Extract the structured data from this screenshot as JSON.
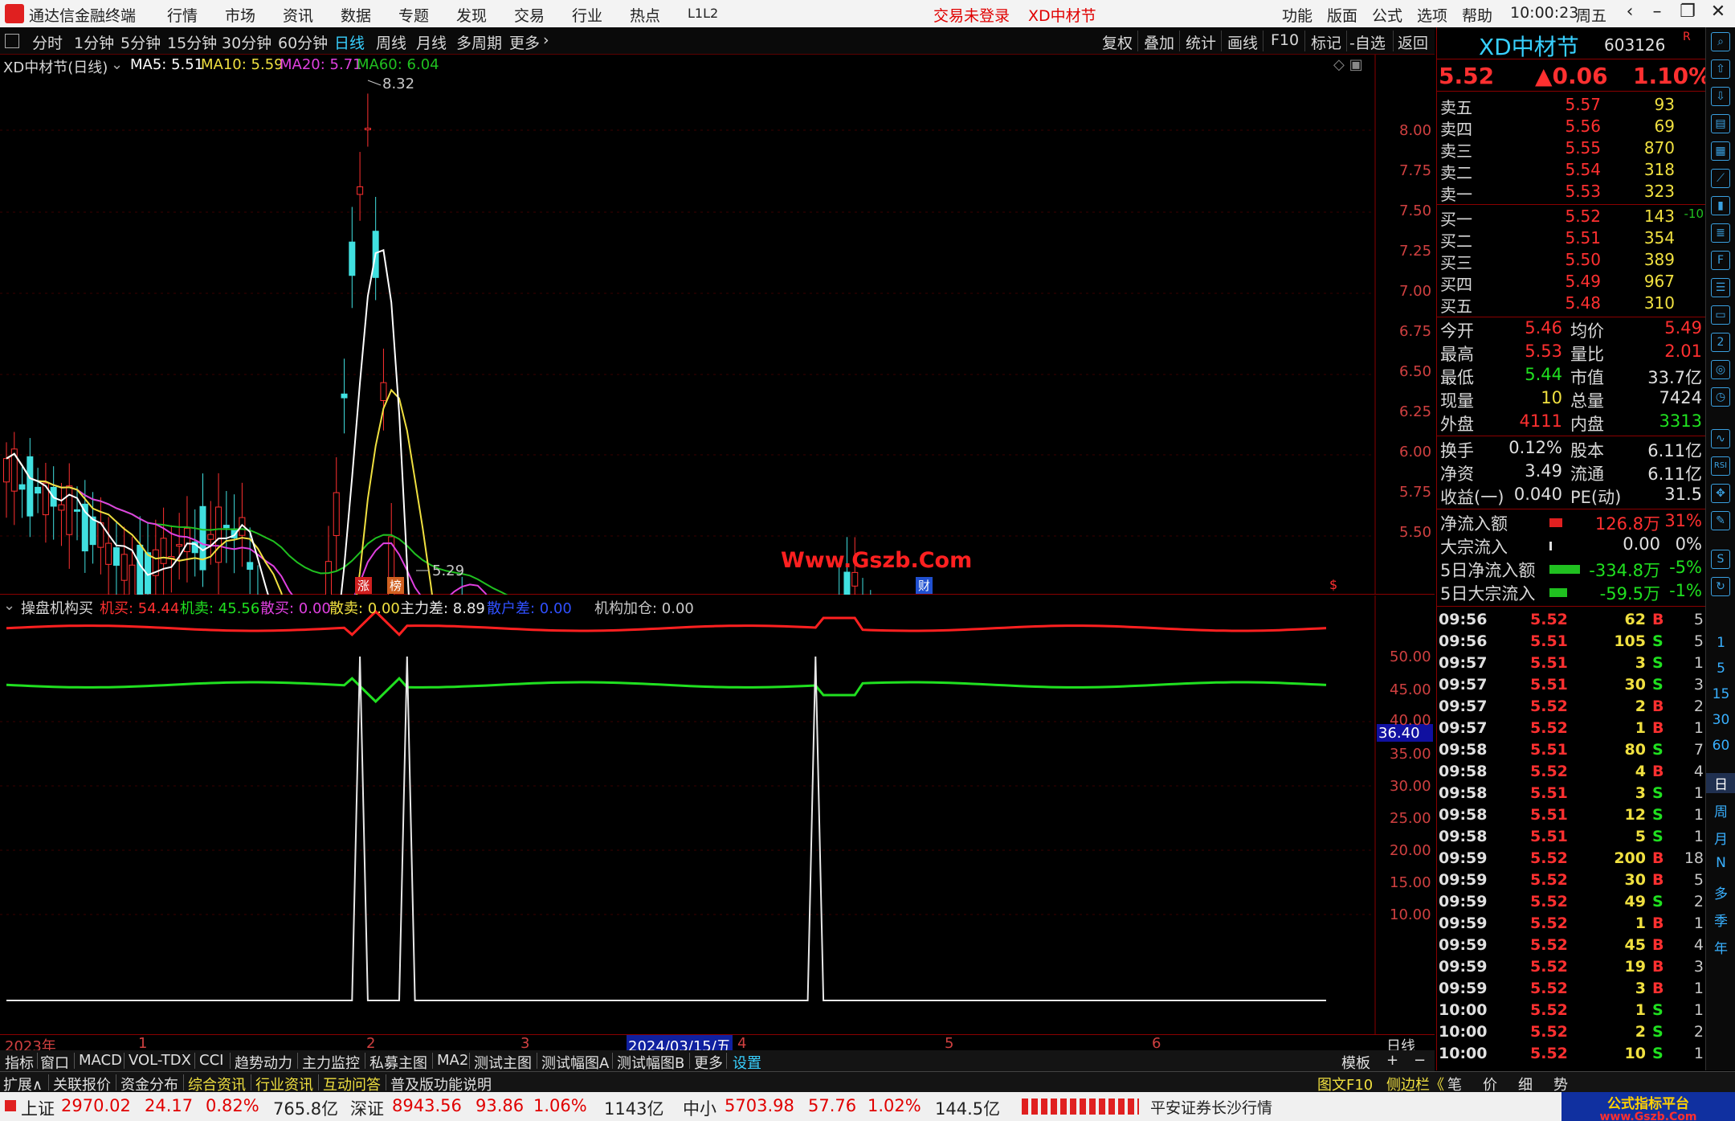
{
  "titlebar": {
    "brand": "通达信金融终端",
    "menu": [
      "行情",
      "市场",
      "资讯",
      "数据",
      "专题",
      "发现",
      "交易",
      "行业",
      "热点",
      "L1L2"
    ],
    "login": "交易未登录",
    "stock": "XD中材节",
    "right_menu": [
      "功能",
      "版面",
      "公式",
      "选项",
      "帮助"
    ],
    "time": "10:00:23",
    "weekday": "周五"
  },
  "periods": [
    "分时",
    "1分钟",
    "5分钟",
    "15分钟",
    "30分钟",
    "60分钟",
    "日线",
    "周线",
    "月线",
    "多周期",
    "更多"
  ],
  "active_period": "日线",
  "toolbar_right": [
    "复权",
    "叠加",
    "统计",
    "画线",
    "F10",
    "标记",
    "-自选",
    "返回"
  ],
  "main_header": {
    "title": "XD中材节(日线)",
    "ma5": "MA5: 5.51",
    "ma10": "MA10: 5.59",
    "ma20": "MA20: 5.71",
    "ma60": "MA60: 6.04"
  },
  "price_axis": [
    "8.00",
    "7.75",
    "7.50",
    "7.25",
    "7.00",
    "6.75",
    "6.50",
    "6.25",
    "6.00",
    "5.75",
    "5.50"
  ],
  "high_label": "8.32",
  "low_label": "5.29",
  "watermark": "Www.Gszb.Com",
  "markers": {
    "zhang": "涨",
    "bang": "榜",
    "cai": "财",
    "s": "$"
  },
  "ind_header": {
    "name": "操盘机构买",
    "jm": "机买: 54.44",
    "jmc": "机卖: 45.56",
    "sm": "散买: 0.00",
    "smc": "散卖: 0.00",
    "zlc": "主力差: 8.89",
    "shc": "散户差: 0.00",
    "jgjc": "机构加仓: 0.00"
  },
  "ind_axis": [
    "50.00",
    "45.00",
    "40.00",
    "35.00",
    "30.00",
    "25.00",
    "20.00",
    "15.00",
    "10.00"
  ],
  "ind_tag": "36.40",
  "datebar": {
    "year": "2023年",
    "m1": "1",
    "m2": "2",
    "m3": "3",
    "date": "2024/03/15/五",
    "m4": "4",
    "m5": "5",
    "m6": "6",
    "period": "日线"
  },
  "tabs1": [
    "指标",
    "窗口",
    "MACD",
    "VOL-TDX",
    "CCI",
    "趋势动力",
    "主力监控",
    "私募主图",
    "MA2",
    "测试主图",
    "测试幅图A",
    "测试幅图B",
    "更多",
    "设置"
  ],
  "tabs1_right": [
    "模板",
    "+",
    "−"
  ],
  "tabs2": [
    "扩展∧",
    "关联报价",
    "资金分布",
    "综合资讯",
    "行业资讯",
    "互动问答",
    "普及版功能说明"
  ],
  "tabs2_right": [
    "图文F10",
    "侧边栏《",
    "笔",
    "价",
    "细",
    "势"
  ],
  "quote": {
    "name": "XD中材节",
    "code": "603126",
    "r": "R",
    "price": "5.52",
    "change": "▲0.06",
    "pct": "1.10%",
    "sells": [
      {
        "label": "卖五",
        "price": "5.57",
        "vol": "93"
      },
      {
        "label": "卖四",
        "price": "5.56",
        "vol": "69"
      },
      {
        "label": "卖三",
        "price": "5.55",
        "vol": "870"
      },
      {
        "label": "卖二",
        "price": "5.54",
        "vol": "318"
      },
      {
        "label": "卖一",
        "price": "5.53",
        "vol": "323"
      }
    ],
    "buys": [
      {
        "label": "买一",
        "price": "5.52",
        "vol": "143",
        "chg": "-10"
      },
      {
        "label": "买二",
        "price": "5.51",
        "vol": "354",
        "chg": ""
      },
      {
        "label": "买三",
        "price": "5.50",
        "vol": "389",
        "chg": ""
      },
      {
        "label": "买四",
        "price": "5.49",
        "vol": "967",
        "chg": ""
      },
      {
        "label": "买五",
        "price": "5.48",
        "vol": "310",
        "chg": ""
      }
    ],
    "stats": [
      [
        "今开",
        "5.46",
        "均价",
        "5.49"
      ],
      [
        "最高",
        "5.53",
        "量比",
        "2.01"
      ],
      [
        "最低",
        "5.44",
        "市值",
        "33.7亿"
      ],
      [
        "现量",
        "10",
        "总量",
        "7424"
      ],
      [
        "外盘",
        "4111",
        "内盘",
        "3313"
      ]
    ],
    "stats2": [
      [
        "换手",
        "0.12%",
        "股本",
        "6.11亿"
      ],
      [
        "净资",
        "3.49",
        "流通",
        "6.11亿"
      ],
      [
        "收益(一)",
        "0.040",
        "PE(动)",
        "31.5"
      ]
    ],
    "flows": [
      {
        "label": "净流入额",
        "val": "126.8万",
        "pct": "31%"
      },
      {
        "label": "大宗流入",
        "val": "0.00",
        "pct": "0%"
      },
      {
        "label": "5日净流入额",
        "val": "-334.8万",
        "pct": "-5%"
      },
      {
        "label": "5日大宗流入",
        "val": "-59.5万",
        "pct": "-1%"
      }
    ],
    "ticks": [
      [
        "09:56",
        "5.52",
        "62",
        "B",
        "5"
      ],
      [
        "09:56",
        "5.51",
        "105",
        "S",
        "5"
      ],
      [
        "09:57",
        "5.51",
        "3",
        "S",
        "1"
      ],
      [
        "09:57",
        "5.51",
        "30",
        "S",
        "3"
      ],
      [
        "09:57",
        "5.52",
        "2",
        "B",
        "2"
      ],
      [
        "09:57",
        "5.52",
        "1",
        "B",
        "1"
      ],
      [
        "09:58",
        "5.51",
        "80",
        "S",
        "7"
      ],
      [
        "09:58",
        "5.52",
        "4",
        "B",
        "4"
      ],
      [
        "09:58",
        "5.51",
        "3",
        "S",
        "1"
      ],
      [
        "09:58",
        "5.51",
        "12",
        "S",
        "1"
      ],
      [
        "09:58",
        "5.51",
        "5",
        "S",
        "1"
      ],
      [
        "09:59",
        "5.52",
        "200",
        "B",
        "18"
      ],
      [
        "09:59",
        "5.52",
        "30",
        "B",
        "5"
      ],
      [
        "09:59",
        "5.52",
        "49",
        "S",
        "2"
      ],
      [
        "09:59",
        "5.52",
        "1",
        "B",
        "1"
      ],
      [
        "09:59",
        "5.52",
        "45",
        "B",
        "4"
      ],
      [
        "09:59",
        "5.52",
        "19",
        "B",
        "3"
      ],
      [
        "09:59",
        "5.52",
        "3",
        "B",
        "1"
      ],
      [
        "10:00",
        "5.52",
        "1",
        "S",
        "1"
      ],
      [
        "10:00",
        "5.52",
        "2",
        "S",
        "2"
      ],
      [
        "10:00",
        "5.52",
        "10",
        "S",
        "1"
      ]
    ]
  },
  "side_tabs": [
    "1",
    "5",
    "15",
    "30",
    "60",
    "日",
    "周",
    "月",
    "N",
    "多",
    "季",
    "年"
  ],
  "status": {
    "sh_name": "上证",
    "sh_val": "2970.02",
    "sh_chg": "24.17",
    "sh_pct": "0.82%",
    "sh_amt": "765.8亿",
    "sz_name": "深证",
    "sz_val": "8943.56",
    "sz_chg": "93.86",
    "sz_pct": "1.06%",
    "sz_amt": "1143亿",
    "zx_name": "中小",
    "zx_val": "5703.98",
    "zx_chg": "57.76",
    "zx_pct": "1.02%",
    "zx_amt": "144.5亿",
    "broker": "平安证券长沙行情",
    "logo": "公式指标平台",
    "logo_url": "www.Gszb.Com"
  },
  "colors": {
    "up": "#ff3030",
    "down": "#40e0e0",
    "ma5": "#ffffff",
    "ma10": "#f0e040",
    "ma20": "#e040e0",
    "ma60": "#20c020",
    "accent": "#38d0ff"
  }
}
